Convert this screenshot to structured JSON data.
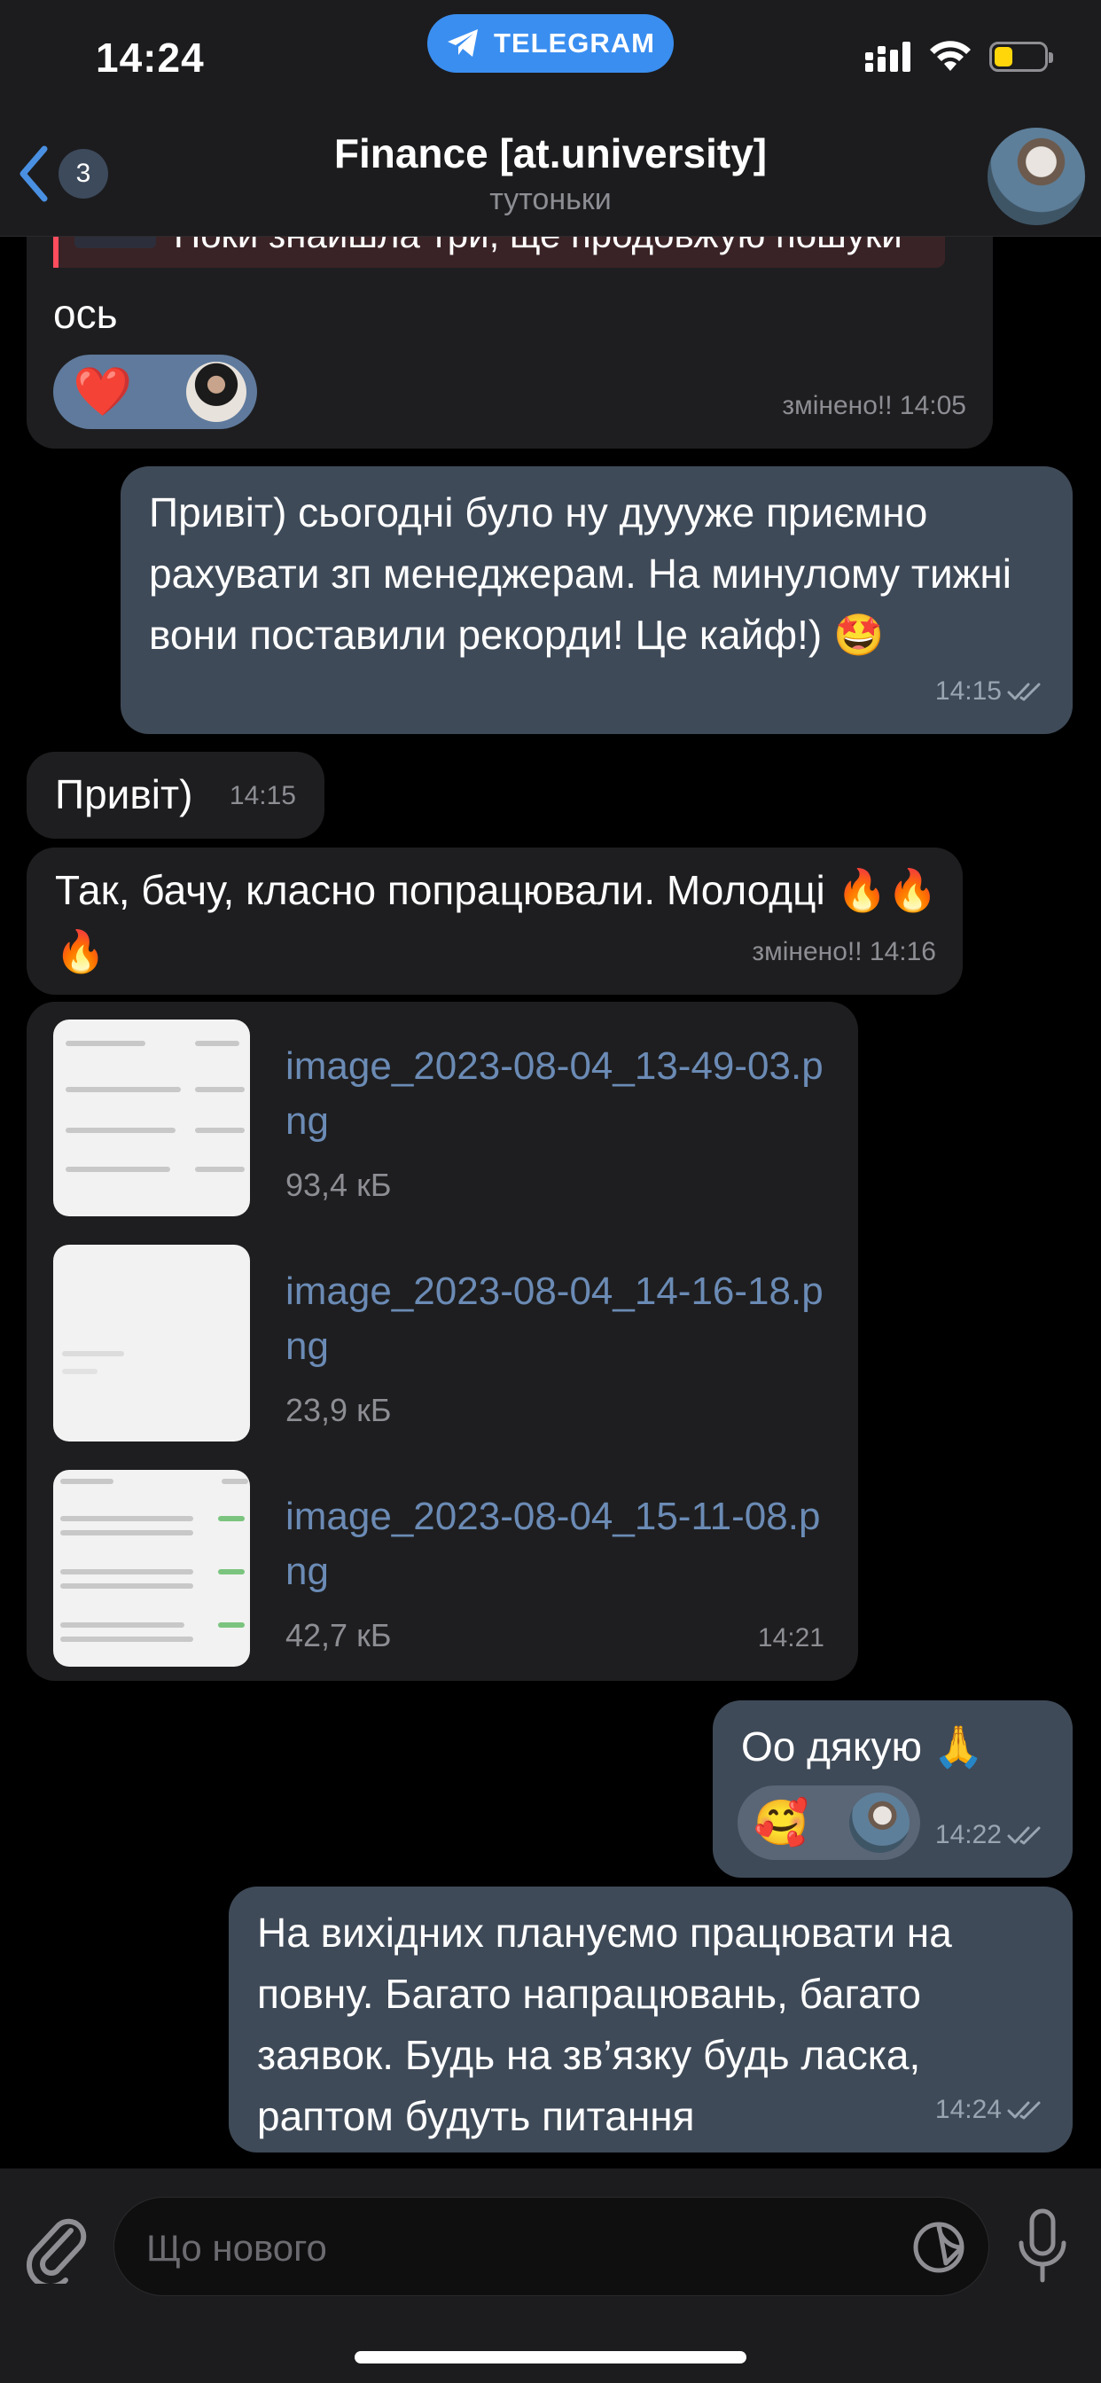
{
  "status_bar": {
    "time": "14:24",
    "banner_label": "TELEGRAM"
  },
  "header": {
    "back_count": "3",
    "title": "Finance [at.university]",
    "subtitle": "тутоньки"
  },
  "messages": [
    {
      "id": "m1",
      "dir": "in",
      "quote": "Поки знайшла три, ще продовжую пошуки",
      "text": "ось",
      "time": "змінено!! 14:05",
      "reactions": [
        "❤️"
      ]
    },
    {
      "id": "m2",
      "dir": "out",
      "text": "Привіт) сьогодні було ну дуууже приємно рахувати зп менеджерам. На минулому тижні вони поставили рекорди! Це кайф!) 🤩",
      "time": "14:15"
    },
    {
      "id": "m3",
      "dir": "in",
      "text": "Привіт)",
      "time": "14:15"
    },
    {
      "id": "m4",
      "dir": "in",
      "text": "Так, бачу, класно попрацювали. Молодці 🔥🔥🔥",
      "time": "змінено!! 14:16"
    },
    {
      "id": "m5",
      "dir": "in",
      "time": "14:21",
      "files": [
        {
          "name": "image_2023-08-04_13-49-03.png",
          "size": "93,4 кБ"
        },
        {
          "name": "image_2023-08-04_14-16-18.png",
          "size": "23,9 кБ"
        },
        {
          "name": "image_2023-08-04_15-11-08.png",
          "size": "42,7 кБ"
        }
      ]
    },
    {
      "id": "m6",
      "dir": "out",
      "text": "Оо дякую 🙏",
      "time": "14:22",
      "reactions": [
        "🥰"
      ]
    },
    {
      "id": "m7",
      "dir": "out",
      "text": "На вихідних плануємо працювати на повну. Багато напрацювань, багато заявок. Будь на зв’язку будь ласка, раптом будуть питання",
      "time": "14:24"
    }
  ],
  "composer": {
    "placeholder": "Що нового"
  },
  "colors": {
    "incoming": "#1e1e20",
    "outgoing": "#3f4a58",
    "link": "#6b8bb5",
    "accent": "#3a8ef0",
    "battery": "#ffd60a"
  },
  "icons": [
    "telegram-icon",
    "signal-icon",
    "wifi-icon",
    "battery-icon",
    "back-chevron-icon",
    "paperclip-icon",
    "sticker-icon",
    "microphone-icon",
    "double-check-icon"
  ]
}
